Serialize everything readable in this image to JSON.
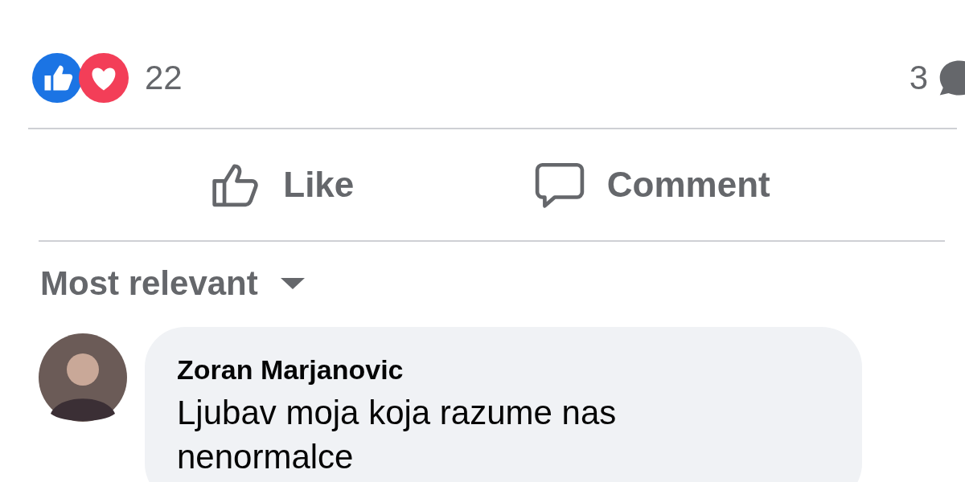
{
  "reactions": {
    "icons": [
      {
        "kind": "like"
      },
      {
        "kind": "love"
      }
    ],
    "count": "22",
    "comments_count": "3"
  },
  "actions": [
    {
      "kind": "like",
      "label": "Like"
    },
    {
      "kind": "comment",
      "label": "Comment"
    }
  ],
  "sort": {
    "label": "Most relevant"
  },
  "comments": [
    {
      "author": "Zoran Marjanovic",
      "text": "Ljubav moja koja razume nas nenormalce"
    }
  ]
}
